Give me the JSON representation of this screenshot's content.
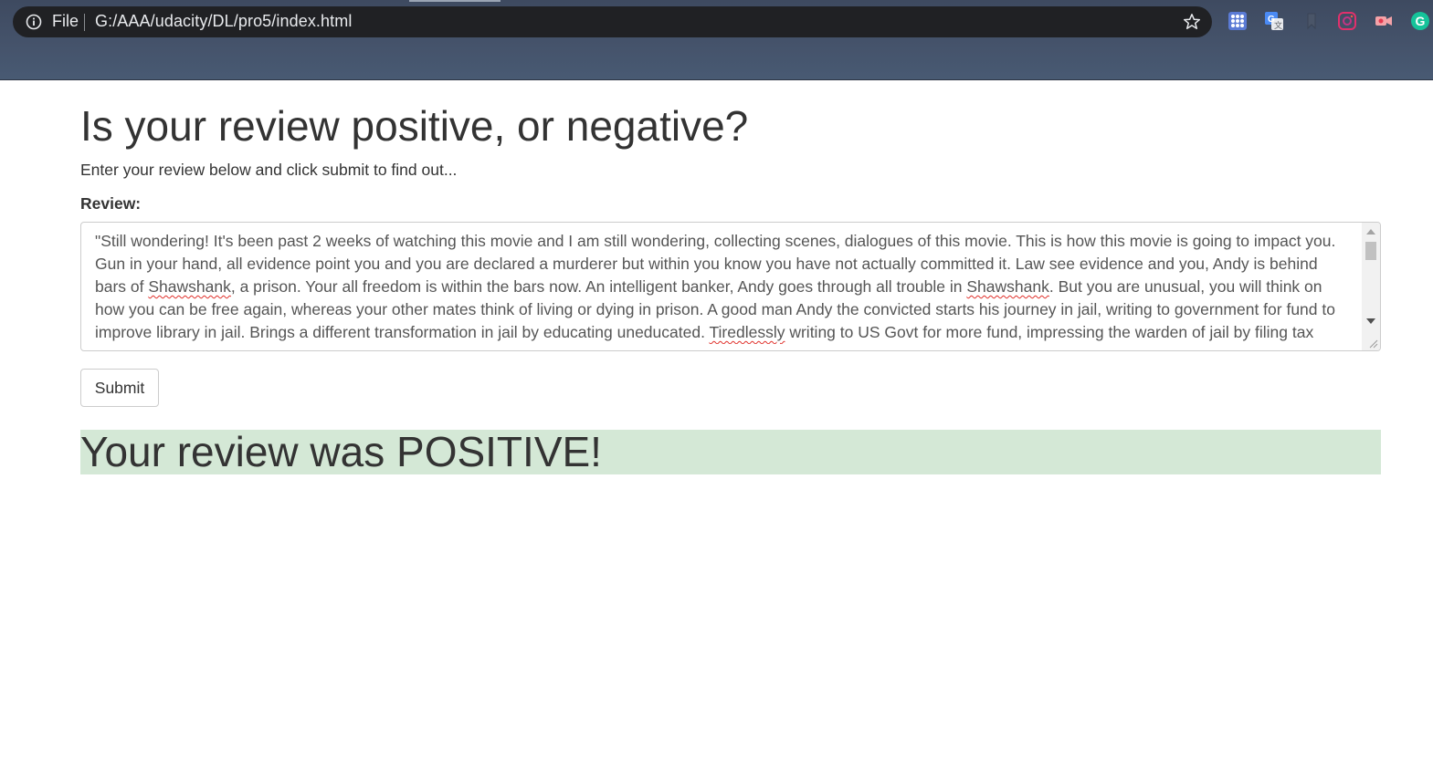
{
  "browser": {
    "file_label": "File",
    "url": "G:/AAA/udacity/DL/pro5/index.html",
    "extensions": [
      "apps-grid-icon",
      "google-translate-icon",
      "bookmark-icon",
      "instagram-icon",
      "video-record-icon",
      "grammarly-icon"
    ]
  },
  "page": {
    "title": "Is your review positive, or negative?",
    "subtitle": "Enter your review below and click submit to find out...",
    "review_label": "Review:",
    "review_text": {
      "seg1": "\"Still wondering! It's been past 2 weeks of watching this movie and I am still wondering, collecting scenes, dialogues of this movie. This is how this movie is going to impact you. Gun in your hand, all evidence point you and you are declared a murderer but within you know you have not actually committed it. Law see evidence and you, Andy is behind bars of ",
      "word1": "Shawshank",
      "seg2": ", a prison. Your all freedom is within the bars now. An intelligent banker, Andy goes through all trouble in ",
      "word2": "Shawshank",
      "seg3": ". But you are unusual, you will think on how you can be free again, whereas your other mates think of living or dying in prison. A good man Andy the convicted starts his journey in jail, writing to government for fund to improve library in jail. Brings a different transformation in jail by educating uneducated. ",
      "word3": "Tiredlessly",
      "seg4": " writing to US Govt for more fund, impressing the warden of jail by filing tax returns and giving protection"
    },
    "submit_label": "Submit",
    "result_text": "Your review was POSITIVE!"
  },
  "colors": {
    "result_bg": "#d4e8d6",
    "chrome_bg": "#45536b",
    "address_bg": "#202124"
  }
}
